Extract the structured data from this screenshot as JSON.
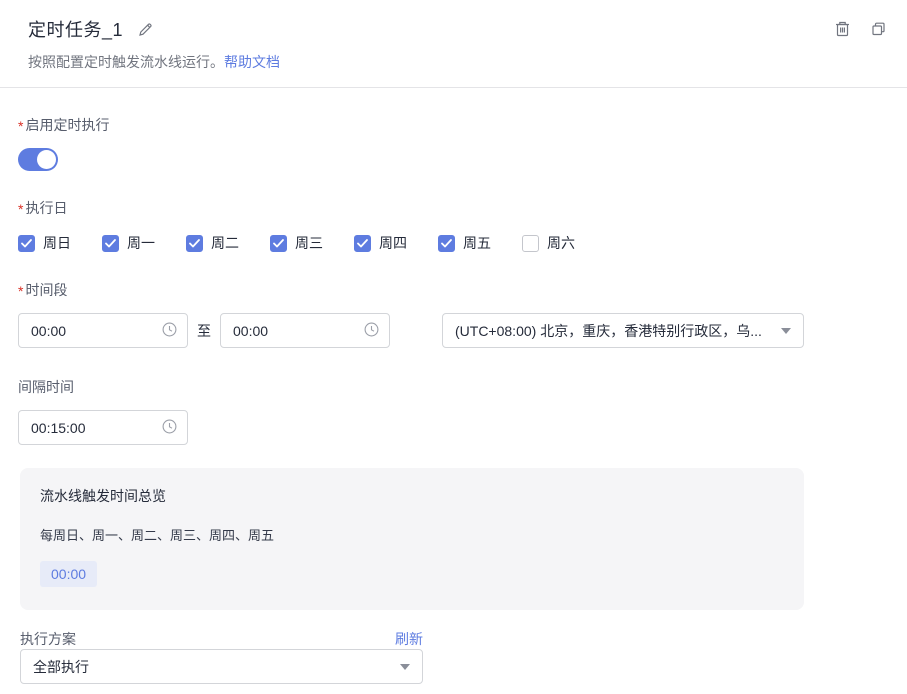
{
  "header": {
    "title": "定时任务_1",
    "subtitle": "按照配置定时触发流水线运行。",
    "help_link": "帮助文档",
    "icons": {
      "edit": "pencil-icon",
      "delete": "trash-icon",
      "copy": "copy-icon"
    }
  },
  "required_marker": "*",
  "form": {
    "enable": {
      "label": "启用定时执行",
      "required": true,
      "value": true
    },
    "days": {
      "label": "执行日",
      "required": true,
      "options": [
        {
          "label": "周日",
          "checked": true
        },
        {
          "label": "周一",
          "checked": true
        },
        {
          "label": "周二",
          "checked": true
        },
        {
          "label": "周三",
          "checked": true
        },
        {
          "label": "周四",
          "checked": true
        },
        {
          "label": "周五",
          "checked": true
        },
        {
          "label": "周六",
          "checked": false
        }
      ]
    },
    "period": {
      "label": "时间段",
      "required": true,
      "start_value": "00:00",
      "to_label": "至",
      "end_value": "00:00",
      "timezone_value": "(UTC+08:00) 北京，重庆，香港特别行政区，乌..."
    },
    "interval": {
      "label": "间隔时间",
      "value": "00:15:00"
    },
    "overview": {
      "title": "流水线触发时间总览",
      "days_text": "每周日、周一、周二、周三、周四、周五",
      "times": [
        "00:00"
      ]
    },
    "plan": {
      "label": "执行方案",
      "refresh_label": "刷新",
      "value": "全部执行"
    }
  },
  "colors": {
    "accent": "#5e7ce0",
    "required_asterisk": "#d93026",
    "label_gray": "#575d6c",
    "text_dark": "#252b3a",
    "panel_bg": "#f5f5f7",
    "chip_bg": "#e7ebf8",
    "border": "#d3d5d9"
  }
}
